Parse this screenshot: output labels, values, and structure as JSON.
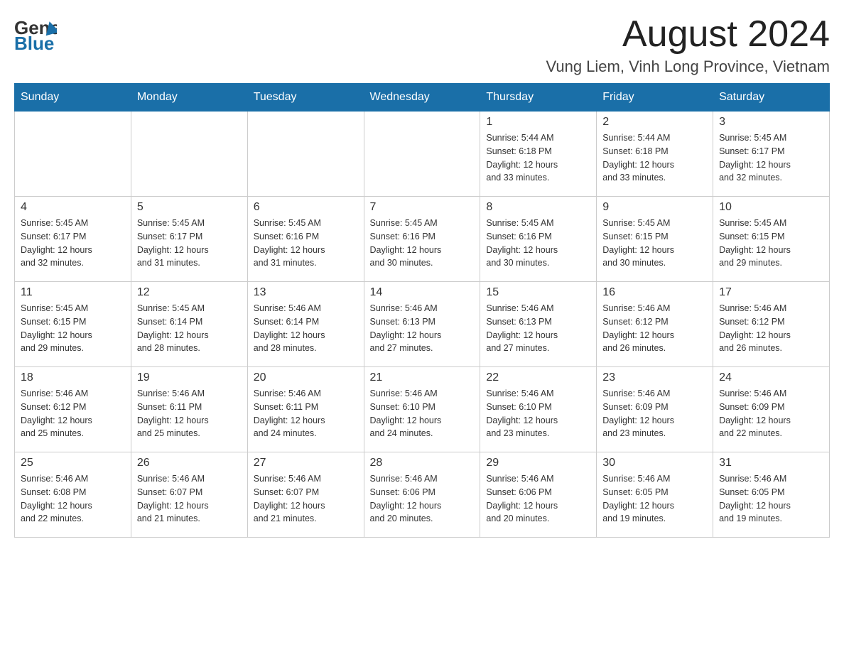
{
  "header": {
    "logo_general": "General",
    "logo_blue": "Blue",
    "month_title": "August 2024",
    "location": "Vung Liem, Vinh Long Province, Vietnam"
  },
  "days_of_week": [
    "Sunday",
    "Monday",
    "Tuesday",
    "Wednesday",
    "Thursday",
    "Friday",
    "Saturday"
  ],
  "weeks": [
    {
      "days": [
        {
          "number": "",
          "info": ""
        },
        {
          "number": "",
          "info": ""
        },
        {
          "number": "",
          "info": ""
        },
        {
          "number": "",
          "info": ""
        },
        {
          "number": "1",
          "info": "Sunrise: 5:44 AM\nSunset: 6:18 PM\nDaylight: 12 hours\nand 33 minutes."
        },
        {
          "number": "2",
          "info": "Sunrise: 5:44 AM\nSunset: 6:18 PM\nDaylight: 12 hours\nand 33 minutes."
        },
        {
          "number": "3",
          "info": "Sunrise: 5:45 AM\nSunset: 6:17 PM\nDaylight: 12 hours\nand 32 minutes."
        }
      ]
    },
    {
      "days": [
        {
          "number": "4",
          "info": "Sunrise: 5:45 AM\nSunset: 6:17 PM\nDaylight: 12 hours\nand 32 minutes."
        },
        {
          "number": "5",
          "info": "Sunrise: 5:45 AM\nSunset: 6:17 PM\nDaylight: 12 hours\nand 31 minutes."
        },
        {
          "number": "6",
          "info": "Sunrise: 5:45 AM\nSunset: 6:16 PM\nDaylight: 12 hours\nand 31 minutes."
        },
        {
          "number": "7",
          "info": "Sunrise: 5:45 AM\nSunset: 6:16 PM\nDaylight: 12 hours\nand 30 minutes."
        },
        {
          "number": "8",
          "info": "Sunrise: 5:45 AM\nSunset: 6:16 PM\nDaylight: 12 hours\nand 30 minutes."
        },
        {
          "number": "9",
          "info": "Sunrise: 5:45 AM\nSunset: 6:15 PM\nDaylight: 12 hours\nand 30 minutes."
        },
        {
          "number": "10",
          "info": "Sunrise: 5:45 AM\nSunset: 6:15 PM\nDaylight: 12 hours\nand 29 minutes."
        }
      ]
    },
    {
      "days": [
        {
          "number": "11",
          "info": "Sunrise: 5:45 AM\nSunset: 6:15 PM\nDaylight: 12 hours\nand 29 minutes."
        },
        {
          "number": "12",
          "info": "Sunrise: 5:45 AM\nSunset: 6:14 PM\nDaylight: 12 hours\nand 28 minutes."
        },
        {
          "number": "13",
          "info": "Sunrise: 5:46 AM\nSunset: 6:14 PM\nDaylight: 12 hours\nand 28 minutes."
        },
        {
          "number": "14",
          "info": "Sunrise: 5:46 AM\nSunset: 6:13 PM\nDaylight: 12 hours\nand 27 minutes."
        },
        {
          "number": "15",
          "info": "Sunrise: 5:46 AM\nSunset: 6:13 PM\nDaylight: 12 hours\nand 27 minutes."
        },
        {
          "number": "16",
          "info": "Sunrise: 5:46 AM\nSunset: 6:12 PM\nDaylight: 12 hours\nand 26 minutes."
        },
        {
          "number": "17",
          "info": "Sunrise: 5:46 AM\nSunset: 6:12 PM\nDaylight: 12 hours\nand 26 minutes."
        }
      ]
    },
    {
      "days": [
        {
          "number": "18",
          "info": "Sunrise: 5:46 AM\nSunset: 6:12 PM\nDaylight: 12 hours\nand 25 minutes."
        },
        {
          "number": "19",
          "info": "Sunrise: 5:46 AM\nSunset: 6:11 PM\nDaylight: 12 hours\nand 25 minutes."
        },
        {
          "number": "20",
          "info": "Sunrise: 5:46 AM\nSunset: 6:11 PM\nDaylight: 12 hours\nand 24 minutes."
        },
        {
          "number": "21",
          "info": "Sunrise: 5:46 AM\nSunset: 6:10 PM\nDaylight: 12 hours\nand 24 minutes."
        },
        {
          "number": "22",
          "info": "Sunrise: 5:46 AM\nSunset: 6:10 PM\nDaylight: 12 hours\nand 23 minutes."
        },
        {
          "number": "23",
          "info": "Sunrise: 5:46 AM\nSunset: 6:09 PM\nDaylight: 12 hours\nand 23 minutes."
        },
        {
          "number": "24",
          "info": "Sunrise: 5:46 AM\nSunset: 6:09 PM\nDaylight: 12 hours\nand 22 minutes."
        }
      ]
    },
    {
      "days": [
        {
          "number": "25",
          "info": "Sunrise: 5:46 AM\nSunset: 6:08 PM\nDaylight: 12 hours\nand 22 minutes."
        },
        {
          "number": "26",
          "info": "Sunrise: 5:46 AM\nSunset: 6:07 PM\nDaylight: 12 hours\nand 21 minutes."
        },
        {
          "number": "27",
          "info": "Sunrise: 5:46 AM\nSunset: 6:07 PM\nDaylight: 12 hours\nand 21 minutes."
        },
        {
          "number": "28",
          "info": "Sunrise: 5:46 AM\nSunset: 6:06 PM\nDaylight: 12 hours\nand 20 minutes."
        },
        {
          "number": "29",
          "info": "Sunrise: 5:46 AM\nSunset: 6:06 PM\nDaylight: 12 hours\nand 20 minutes."
        },
        {
          "number": "30",
          "info": "Sunrise: 5:46 AM\nSunset: 6:05 PM\nDaylight: 12 hours\nand 19 minutes."
        },
        {
          "number": "31",
          "info": "Sunrise: 5:46 AM\nSunset: 6:05 PM\nDaylight: 12 hours\nand 19 minutes."
        }
      ]
    }
  ]
}
